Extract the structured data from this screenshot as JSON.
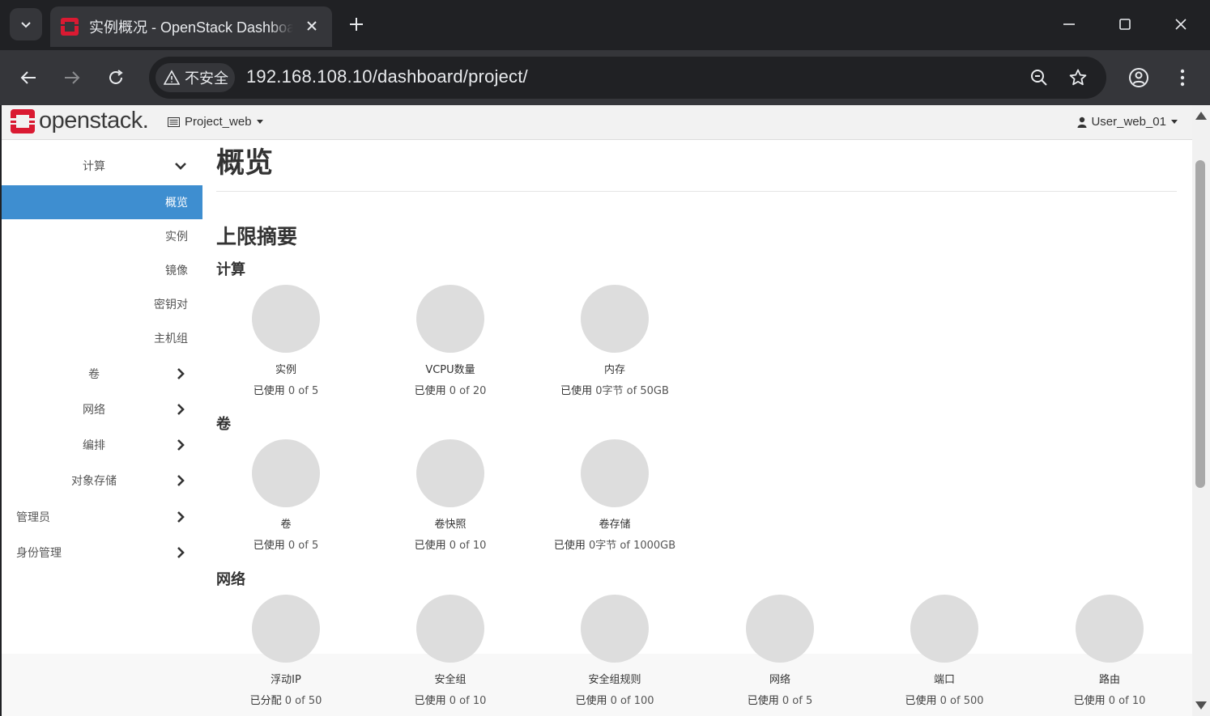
{
  "browser": {
    "tab_title": "实例概况 - OpenStack Dashboard",
    "security_label": "不安全",
    "url": "192.168.108.10/dashboard/project/"
  },
  "topnav": {
    "logo_text": "openstack.",
    "project": "Project_web",
    "user": "User_web_01"
  },
  "sidebar": {
    "compute": "计算",
    "overview": "概览",
    "instances": "实例",
    "images": "镜像",
    "keypairs": "密钥对",
    "server_groups": "主机组",
    "volumes": "卷",
    "network": "网络",
    "orchestration": "编排",
    "object_store": "对象存储",
    "admin": "管理员",
    "identity": "身份管理"
  },
  "main": {
    "title": "概览",
    "summary_heading": "上限摘要",
    "sections": [
      {
        "heading": "计算",
        "items": [
          {
            "label": "实例",
            "prefix": "已使用",
            "value": "0 of 5"
          },
          {
            "label": "VCPU数量",
            "prefix": "已使用",
            "value": "0 of 20"
          },
          {
            "label": "内存",
            "prefix": "已使用",
            "value": "0字节 of 50GB"
          }
        ]
      },
      {
        "heading": "卷",
        "items": [
          {
            "label": "卷",
            "prefix": "已使用",
            "value": "0 of 5"
          },
          {
            "label": "卷快照",
            "prefix": "已使用",
            "value": "0 of 10"
          },
          {
            "label": "卷存储",
            "prefix": "已使用",
            "value": "0字节 of 1000GB"
          }
        ]
      },
      {
        "heading": "网络",
        "items": [
          {
            "label": "浮动IP",
            "prefix": "已分配",
            "value": "0 of 50"
          },
          {
            "label": "安全组",
            "prefix": "已使用",
            "value": "0 of 10"
          },
          {
            "label": "安全组规则",
            "prefix": "已使用",
            "value": "0 of 100"
          },
          {
            "label": "网络",
            "prefix": "已使用",
            "value": "0 of 5"
          },
          {
            "label": "端口",
            "prefix": "已使用",
            "value": "0 of 500"
          },
          {
            "label": "路由",
            "prefix": "已使用",
            "value": "0 of 10"
          }
        ]
      }
    ]
  },
  "colors": {
    "accent": "#3e8ed0",
    "openstack_red": "#da1a32",
    "pie_gray": "#dddddd"
  }
}
